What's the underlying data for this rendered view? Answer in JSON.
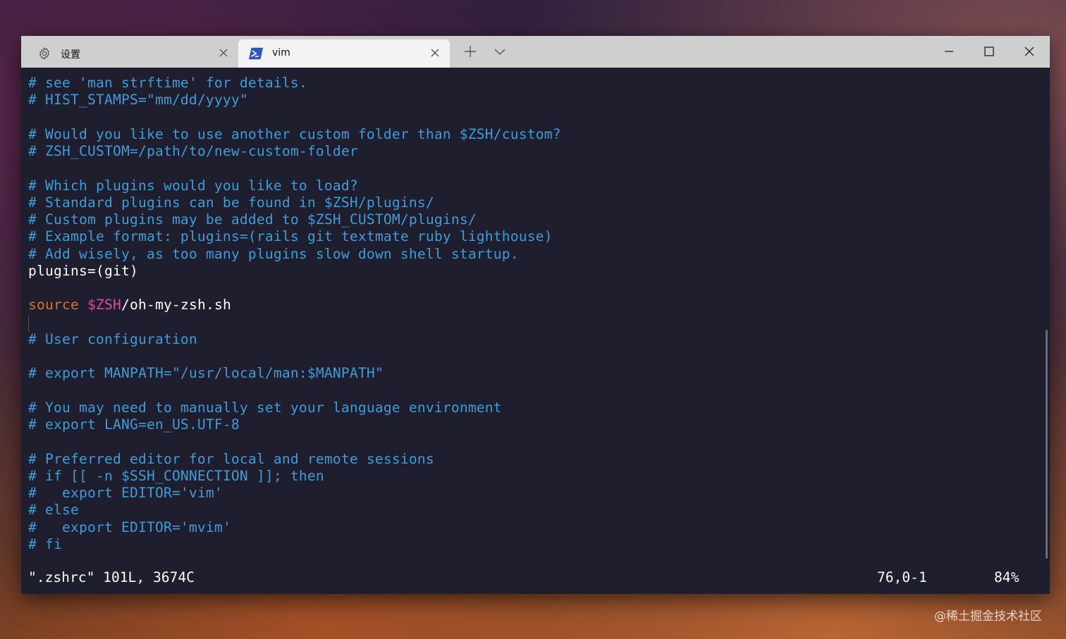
{
  "tabs": [
    {
      "label": "设置",
      "icon": "gear-icon",
      "active": false
    },
    {
      "label": "vim",
      "icon": "powershell-icon",
      "active": true
    }
  ],
  "toolbar": {
    "new_tab_icon": "plus-icon",
    "dropdown_icon": "chevron-down-icon"
  },
  "window_controls": {
    "minimize": "minimize-icon",
    "maximize": "maximize-icon",
    "close": "close-icon"
  },
  "editor": {
    "lines": [
      {
        "segments": [
          {
            "t": "# see 'man strftime' for details.",
            "k": "c"
          }
        ]
      },
      {
        "segments": [
          {
            "t": "# HIST_STAMPS=\"mm/dd/yyyy\"",
            "k": "c"
          }
        ]
      },
      {
        "segments": []
      },
      {
        "segments": [
          {
            "t": "# Would you like to use another custom folder than $ZSH/custom?",
            "k": "c"
          }
        ]
      },
      {
        "segments": [
          {
            "t": "# ZSH_CUSTOM=/path/to/new-custom-folder",
            "k": "c"
          }
        ]
      },
      {
        "segments": []
      },
      {
        "segments": [
          {
            "t": "# Which plugins would you like to load?",
            "k": "c"
          }
        ]
      },
      {
        "segments": [
          {
            "t": "# Standard plugins can be found in $ZSH/plugins/",
            "k": "c"
          }
        ]
      },
      {
        "segments": [
          {
            "t": "# Custom plugins may be added to $ZSH_CUSTOM/plugins/",
            "k": "c"
          }
        ]
      },
      {
        "segments": [
          {
            "t": "# Example format: plugins=(rails git textmate ruby lighthouse)",
            "k": "c"
          }
        ]
      },
      {
        "segments": [
          {
            "t": "# Add wisely, as too many plugins slow down shell startup.",
            "k": "c"
          }
        ]
      },
      {
        "segments": [
          {
            "t": "plugins=(git)",
            "k": "p"
          }
        ]
      },
      {
        "segments": []
      },
      {
        "segments": [
          {
            "t": "source",
            "k": "kw"
          },
          {
            "t": " ",
            "k": "p"
          },
          {
            "t": "$ZSH",
            "k": "var"
          },
          {
            "t": "/oh-my-zsh.sh",
            "k": "p"
          }
        ]
      },
      {
        "segments": []
      },
      {
        "segments": [
          {
            "t": "# User configuration",
            "k": "c"
          }
        ]
      },
      {
        "segments": []
      },
      {
        "segments": [
          {
            "t": "# export MANPATH=\"/usr/local/man:$MANPATH\"",
            "k": "c"
          }
        ]
      },
      {
        "segments": []
      },
      {
        "segments": [
          {
            "t": "# You may need to manually set your language environment",
            "k": "c"
          }
        ]
      },
      {
        "segments": [
          {
            "t": "# export LANG=en_US.UTF-8",
            "k": "c"
          }
        ]
      },
      {
        "segments": []
      },
      {
        "segments": [
          {
            "t": "# Preferred editor for local and remote sessions",
            "k": "c"
          }
        ]
      },
      {
        "segments": [
          {
            "t": "# if [[ -n $SSH_CONNECTION ]]; then",
            "k": "c"
          }
        ]
      },
      {
        "segments": [
          {
            "t": "#   export EDITOR='vim'",
            "k": "c"
          }
        ]
      },
      {
        "segments": [
          {
            "t": "# else",
            "k": "c"
          }
        ]
      },
      {
        "segments": [
          {
            "t": "#   export EDITOR='mvim'",
            "k": "c"
          }
        ]
      },
      {
        "segments": [
          {
            "t": "# fi",
            "k": "c"
          }
        ]
      }
    ]
  },
  "statusline": {
    "file_info": "\".zshrc\" 101L, 3674C",
    "cursor_position": "76,0-1",
    "scroll_percent": "84%"
  },
  "colors": {
    "comment": "#3d9dd9",
    "keyword": "#d8742d",
    "variable": "#e0479e",
    "background": "#1e1e2e"
  },
  "watermark": "@稀土掘金技术社区"
}
